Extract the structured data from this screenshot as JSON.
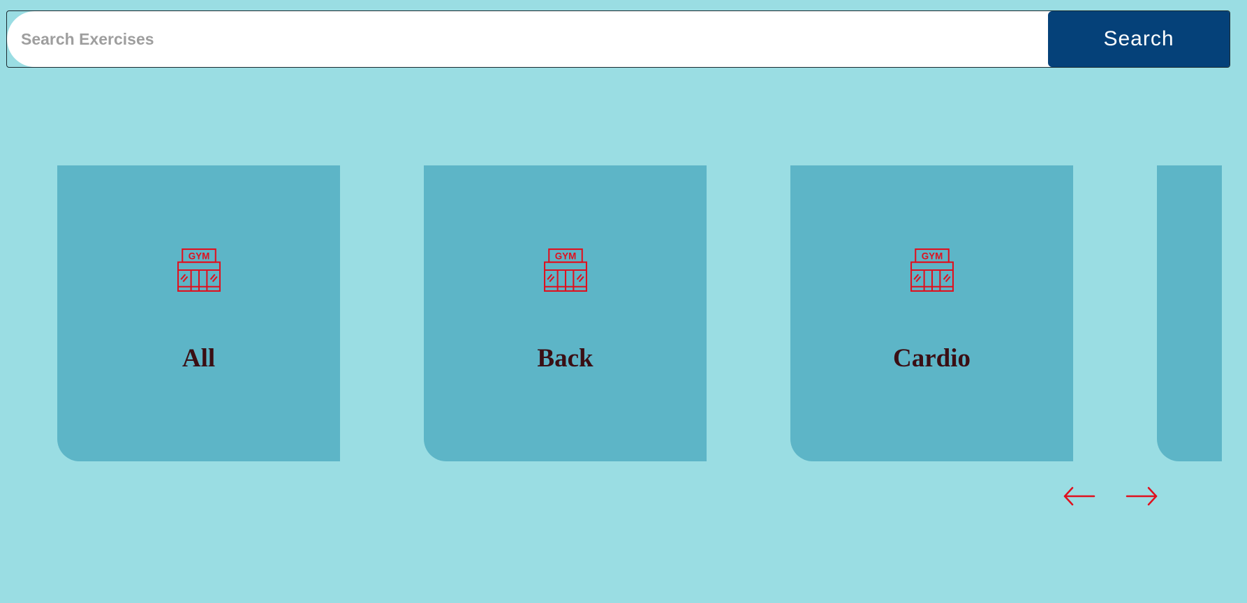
{
  "search": {
    "placeholder": "Search Exercises",
    "value": "",
    "button_label": "Search"
  },
  "categories": [
    {
      "label": "All",
      "icon": "gym-icon"
    },
    {
      "label": "Back",
      "icon": "gym-icon"
    },
    {
      "label": "Cardio",
      "icon": "gym-icon"
    },
    {
      "label": "",
      "icon": "gym-icon"
    }
  ],
  "gym_icon_text": "GYM",
  "navigation": {
    "prev_icon": "arrow-left-icon",
    "next_icon": "arrow-right-icon"
  },
  "colors": {
    "background": "#9adde3",
    "card": "#5db5c7",
    "search_button": "#054179",
    "icon_accent": "#e0101e",
    "label_text": "#3a0f14"
  }
}
